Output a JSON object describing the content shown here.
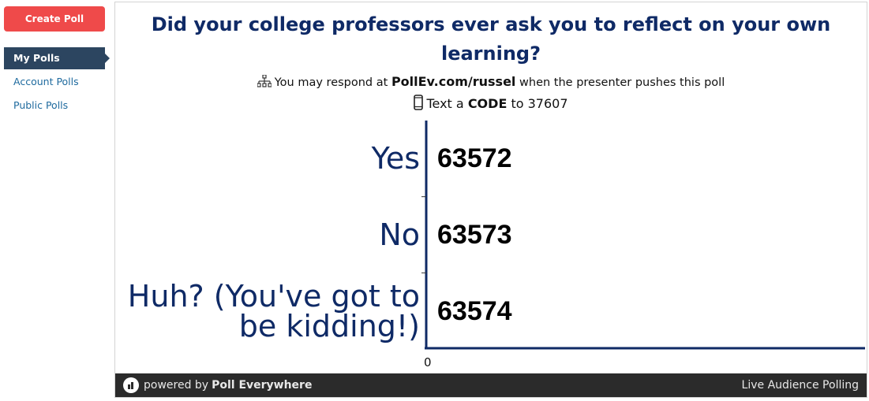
{
  "sidebar": {
    "create_button": "Create Poll",
    "items": [
      {
        "label": "My Polls",
        "active": true
      },
      {
        "label": "Account Polls",
        "active": false
      },
      {
        "label": "Public Polls",
        "active": false
      }
    ]
  },
  "poll": {
    "title": "Did your college professors ever ask you to reflect on your own learning?",
    "respond_prefix": "You may respond at",
    "respond_url": "PollEv.com/russel",
    "respond_suffix": "when the presenter pushes this poll",
    "text_prefix": "Text a",
    "text_code": "CODE",
    "text_to": "to",
    "text_number": "37607"
  },
  "chart_data": {
    "type": "bar",
    "orientation": "horizontal",
    "categories": [
      "Yes",
      "No",
      "Huh? (You've got to be kidding!)"
    ],
    "codes": [
      "63572",
      "63573",
      "63574"
    ],
    "values": [
      0,
      0,
      0
    ],
    "xtick_labels": [
      "0"
    ]
  },
  "footer": {
    "powered_by": "powered by",
    "brand": "Poll Everywhere",
    "right": "Live Audience Polling"
  },
  "colors": {
    "accent": "#ef4a4a",
    "nav_active": "#2c4560",
    "title": "#0f2a66",
    "footer_bg": "#2b2b2b"
  }
}
